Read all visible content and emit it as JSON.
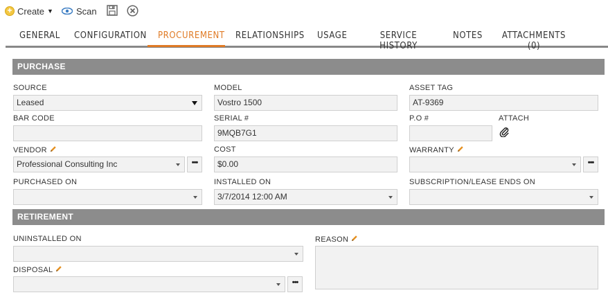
{
  "toolbar": {
    "create_label": "Create",
    "scan_label": "Scan"
  },
  "tabs": [
    {
      "label": "GENERAL"
    },
    {
      "label": "CONFIGURATION"
    },
    {
      "label": "PROCUREMENT"
    },
    {
      "label": "RELATIONSHIPS"
    },
    {
      "label": "USAGE"
    },
    {
      "label": "SERVICE HISTORY"
    },
    {
      "label": "NOTES"
    },
    {
      "label": "ATTACHMENTS (0)"
    }
  ],
  "active_tab": "PROCUREMENT",
  "purchase": {
    "title": "PURCHASE",
    "source": {
      "label": "SOURCE",
      "value": "Leased"
    },
    "model": {
      "label": "MODEL",
      "value": "Vostro 1500"
    },
    "asset_tag": {
      "label": "ASSET TAG",
      "value": "AT-9369"
    },
    "bar_code": {
      "label": "BAR CODE",
      "value": ""
    },
    "serial": {
      "label": "SERIAL #",
      "value": "9MQB7G1"
    },
    "po": {
      "label": "P.O #",
      "value": ""
    },
    "attach": {
      "label": "ATTACH"
    },
    "vendor": {
      "label": "VENDOR",
      "value": "Professional Consulting Inc"
    },
    "cost": {
      "label": "COST",
      "value": "$0.00"
    },
    "warranty": {
      "label": "WARRANTY",
      "value": ""
    },
    "purchased_on": {
      "label": "PURCHASED ON",
      "value": ""
    },
    "installed_on": {
      "label": "INSTALLED ON",
      "value": "3/7/2014 12:00 AM"
    },
    "subscription_ends": {
      "label": "SUBSCRIPTION/LEASE ENDS ON",
      "value": ""
    }
  },
  "retirement": {
    "title": "RETIREMENT",
    "uninstalled_on": {
      "label": "UNINSTALLED ON",
      "value": ""
    },
    "reason": {
      "label": "REASON",
      "value": ""
    },
    "disposal": {
      "label": "DISPOSAL",
      "value": ""
    }
  },
  "ellipsis_label": "•••",
  "colors": {
    "accent": "#e07b26",
    "section_bg": "#8c8c8c",
    "field_bg": "#f2f2f2",
    "create_icon": "#f3c743",
    "scan_icon": "#3a7cc3"
  },
  "icons": {
    "create": "plus-circle-icon",
    "scan": "eye-icon",
    "save": "floppy-disk-icon",
    "close": "close-circle-icon",
    "edit": "pencil-icon",
    "attach": "paperclip-icon"
  }
}
